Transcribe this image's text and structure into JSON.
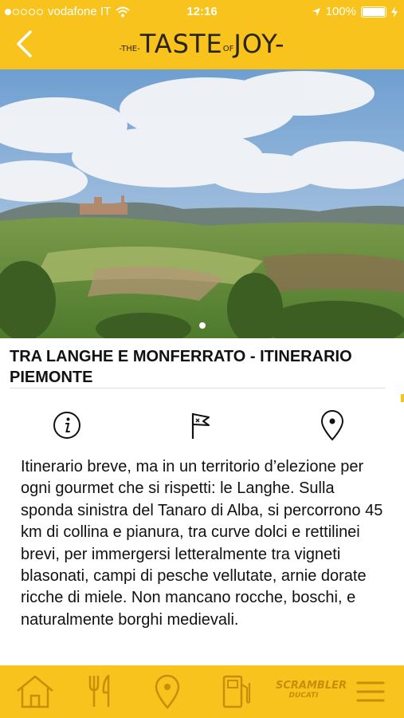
{
  "status": {
    "carrier": "vodafone IT",
    "time": "12:16",
    "battery": "100%"
  },
  "header": {
    "logo_the": "-THE-",
    "logo_taste": "TASTE",
    "logo_of": "OF",
    "logo_joy": "JOY-"
  },
  "hero": {
    "image": "landscape-photo-langhe-hills",
    "slide_index": 1,
    "slide_count": 1
  },
  "page_title": "TRA LANGHE E MONFERRATO - ITINERARIO PIEMONTE",
  "actions": {
    "info_icon": "info-icon",
    "route_icon": "flag-route-icon",
    "map_icon": "location-pin-icon"
  },
  "description": "Itinerario breve, ma in un territorio d’elezione per ogni gourmet che si rispetti: le Langhe. Sulla sponda sinistra del Tanaro di Alba, si percorrono 45 km di collina e pianura, tra curve dolci e rettilinei brevi, per immergersi letteralmente tra vigneti blasonati, campi di pesche vellutate, arnie dorate ricche di miele. Non mancano rocche, boschi, e naturalmente borghi medievali.",
  "tabbar": {
    "scrambler_line1": "SCRAMBLER",
    "scrambler_line2": "DUCATI",
    "icons": [
      "home-icon",
      "fork-knife-icon",
      "location-pin-icon",
      "fuel-pump-icon",
      "scrambler-logo",
      "menu-icon"
    ]
  },
  "colors": {
    "accent": "#f7c31c",
    "dark": "#2a2418",
    "icon_on_accent": "#c98d0a"
  }
}
